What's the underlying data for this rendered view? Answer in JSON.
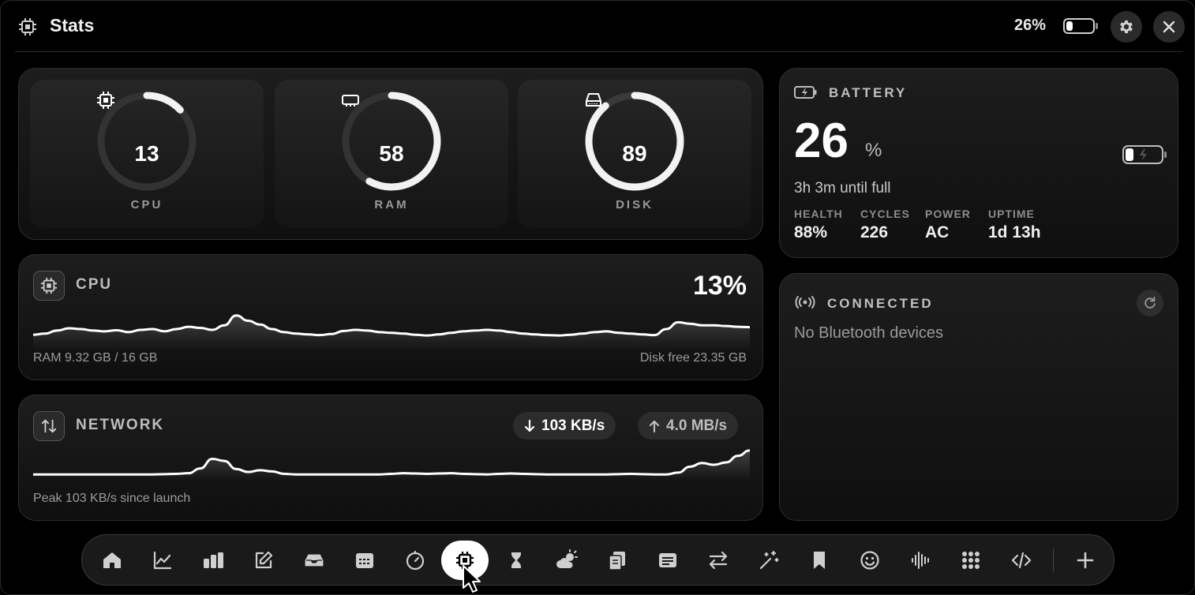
{
  "header": {
    "title": "Stats",
    "battery_percent": "26%"
  },
  "gauges": [
    {
      "label": "CPU",
      "value": "13",
      "percent": 13,
      "icon": "cpu-icon"
    },
    {
      "label": "RAM",
      "value": "58",
      "percent": 58,
      "icon": "memory-icon"
    },
    {
      "label": "DISK",
      "value": "89",
      "percent": 89,
      "icon": "disk-icon"
    }
  ],
  "cpu_panel": {
    "title": "CPU",
    "percent": "13%",
    "ram": "RAM 9.32 GB / 16 GB",
    "disk_free": "Disk free 23.35 GB",
    "history": [
      0.35,
      0.38,
      0.46,
      0.52,
      0.5,
      0.46,
      0.44,
      0.47,
      0.42,
      0.48,
      0.5,
      0.44,
      0.5,
      0.56,
      0.53,
      0.48,
      0.6,
      0.86,
      0.72,
      0.62,
      0.5,
      0.42,
      0.38,
      0.36,
      0.34,
      0.37,
      0.45,
      0.48,
      0.46,
      0.42,
      0.4,
      0.38,
      0.35,
      0.33,
      0.36,
      0.4,
      0.44,
      0.46,
      0.48,
      0.46,
      0.42,
      0.38,
      0.36,
      0.34,
      0.33,
      0.35,
      0.38,
      0.42,
      0.44,
      0.4,
      0.38,
      0.36,
      0.34,
      0.5,
      0.68,
      0.64,
      0.6,
      0.6,
      0.58,
      0.56,
      0.55
    ]
  },
  "network": {
    "title": "NETWORK",
    "download": "103 KB/s",
    "upload": "4.0 MB/s",
    "peak": "Peak 103 KB/s since launch",
    "history": [
      0.1,
      0.1,
      0.1,
      0.1,
      0.1,
      0.1,
      0.1,
      0.1,
      0.1,
      0.1,
      0.1,
      0.11,
      0.12,
      0.14,
      0.3,
      0.62,
      0.55,
      0.28,
      0.18,
      0.24,
      0.2,
      0.12,
      0.1,
      0.1,
      0.1,
      0.1,
      0.1,
      0.1,
      0.1,
      0.1,
      0.12,
      0.14,
      0.13,
      0.12,
      0.13,
      0.14,
      0.12,
      0.11,
      0.1,
      0.12,
      0.13,
      0.12,
      0.11,
      0.1,
      0.1,
      0.1,
      0.1,
      0.1,
      0.1,
      0.11,
      0.12,
      0.11,
      0.1,
      0.1,
      0.16,
      0.36,
      0.48,
      0.42,
      0.5,
      0.72,
      0.9
    ]
  },
  "battery": {
    "title": "BATTERY",
    "value": "26",
    "unit": "%",
    "status": "3h 3m until full",
    "stats": [
      {
        "label": "HEALTH",
        "value": "88%"
      },
      {
        "label": "CYCLES",
        "value": "226"
      },
      {
        "label": "POWER",
        "value": "AC"
      },
      {
        "label": "UPTIME",
        "value": "1d 13h"
      }
    ]
  },
  "bluetooth": {
    "title": "CONNECTED",
    "empty": "No Bluetooth devices"
  },
  "dock": {
    "items": [
      "home-icon",
      "chart-line-icon",
      "bar-chart-icon",
      "compose-icon",
      "inbox-icon",
      "calendar-icon",
      "timer-icon",
      "chip-icon",
      "hourglass-icon",
      "weather-icon",
      "clipboard-icon",
      "news-icon",
      "transfer-icon",
      "sparkle-icon",
      "bookmark-icon",
      "emoji-icon",
      "audio-wave-icon",
      "grid-icon",
      "code-icon",
      "plus-icon"
    ],
    "active": "chip-icon"
  },
  "colors": {
    "background": "#000000",
    "panel": "#161616",
    "accent": "#ffffff",
    "muted": "#9c9c9c"
  }
}
